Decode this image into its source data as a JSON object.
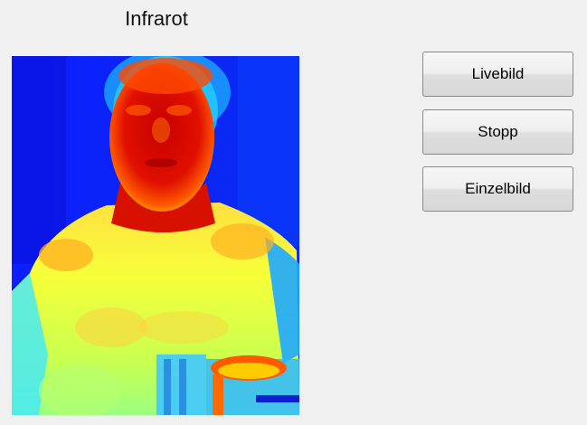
{
  "window": {
    "title": "Infrarot"
  },
  "controls": {
    "live_label": "Livebild",
    "stop_label": "Stopp",
    "single_label": "Einzelbild"
  },
  "thermal_image": {
    "palette": "jet",
    "colors": {
      "cold": "#0a23ff",
      "cool": "#18a8ff",
      "mid": "#7dff7d",
      "warm": "#ffff33",
      "hot": "#ff6a00",
      "hottest": "#c80000"
    }
  }
}
